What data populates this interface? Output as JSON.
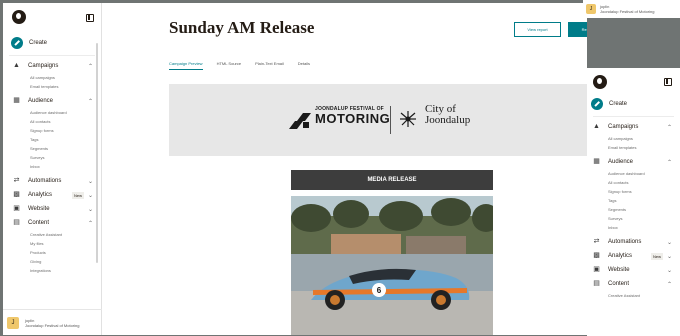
{
  "sidebar": {
    "create_label": "Create",
    "sections": [
      {
        "label": "Campaigns",
        "icon": "campaigns-icon",
        "expanded": true,
        "items": [
          "All campaigns",
          "Email templates"
        ]
      },
      {
        "label": "Audience",
        "icon": "audience-icon",
        "expanded": true,
        "items": [
          "Audience dashboard",
          "All contacts",
          "Signup forms",
          "Tags",
          "Segments",
          "Surveys",
          "Inbox"
        ]
      },
      {
        "label": "Automations",
        "icon": "automations-icon",
        "expanded": false,
        "items": []
      },
      {
        "label": "Analytics",
        "icon": "analytics-icon",
        "badge": "New",
        "expanded": false,
        "items": []
      },
      {
        "label": "Website",
        "icon": "website-icon",
        "expanded": false,
        "items": []
      },
      {
        "label": "Content",
        "icon": "content-icon",
        "expanded": true,
        "items": [
          "Creative Assistant",
          "My files",
          "Products",
          "Giving",
          "Integrations"
        ]
      }
    ],
    "account": {
      "avatar_letter": "J",
      "name": "joplin",
      "org": "Joondalup Festival of Motoring"
    }
  },
  "overlay_sidebar": {
    "create_label": "Create",
    "sections": [
      {
        "label": "Campaigns",
        "icon": "campaigns-icon",
        "items": [
          "All campaigns",
          "Email templates"
        ]
      },
      {
        "label": "Audience",
        "icon": "audience-icon",
        "items": [
          "Audience dashboard",
          "All contacts",
          "Signup forms",
          "Tags",
          "Segments",
          "Surveys",
          "Inbox"
        ]
      },
      {
        "label": "Automations",
        "icon": "automations-icon",
        "items": []
      },
      {
        "label": "Analytics",
        "icon": "analytics-icon",
        "badge": "New",
        "items": []
      },
      {
        "label": "Website",
        "icon": "website-icon",
        "items": []
      },
      {
        "label": "Content",
        "icon": "content-icon",
        "items": [
          "Creative Assistant"
        ]
      }
    ]
  },
  "toast": {
    "avatar_letter": "J",
    "name": "joplin",
    "org": "Joondalup Festival of Motoring"
  },
  "header": {
    "title": "Sunday AM Release",
    "secondary_button": "View report",
    "primary_button": "Replicate"
  },
  "tabs": [
    {
      "label": "Campaign Preview",
      "active": true
    },
    {
      "label": "HTML Source",
      "active": false
    },
    {
      "label": "Plain-Text Email",
      "active": false
    },
    {
      "label": "Details",
      "active": false
    }
  ],
  "email": {
    "festival_top": "JOONDALUP FESTIVAL OF",
    "festival_big": "MOTORING",
    "city_line1": "City of",
    "city_line2": "Joondalup",
    "banner_text": "MEDIA RELEASE",
    "car_number": "6"
  },
  "colors": {
    "accent": "#007c89",
    "brand_dark": "#241c15",
    "avatar": "#efc76b"
  }
}
